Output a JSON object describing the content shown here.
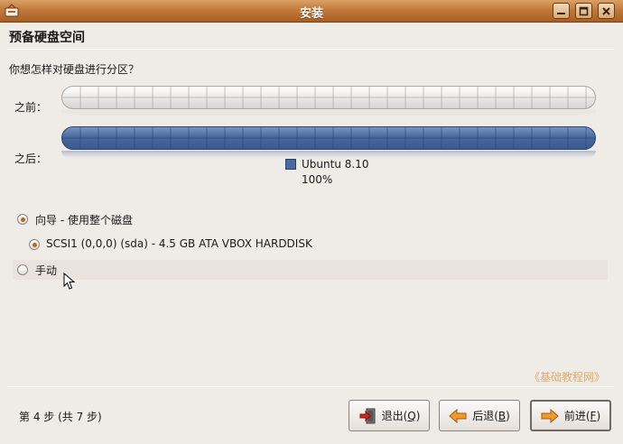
{
  "window": {
    "title": "安装"
  },
  "page": {
    "heading": "预备硬盘空间",
    "question": "你想怎样对硬盘进行分区？"
  },
  "partition": {
    "before_label": "之前：",
    "after_label": "之后：",
    "legend": {
      "name": "Ubuntu 8.10",
      "percent_text": "100%",
      "color": "#4a6a9f"
    },
    "after_fill_fraction": 1.0
  },
  "options": {
    "guided_label": "向导 - 使用整个磁盘",
    "disk_label": "SCSI1 (0,0,0) (sda) - 4.5 GB ATA VBOX HARDDISK",
    "manual_label": "手动",
    "guided_selected": true,
    "disk_selected": true,
    "manual_selected": false
  },
  "watermark": "《基础教程网》",
  "footer": {
    "step_text": "第 4 步 (共 7 步)",
    "quit_label": "退出(",
    "quit_key": "Q",
    "back_label": "后退(",
    "back_key": "B",
    "forward_label": "前进(",
    "forward_key": "F",
    "close_paren": ")"
  },
  "colors": {
    "titlebar": "#c27a3a",
    "accent": "#c2621c",
    "partition_fill": "#4a6a9f"
  }
}
